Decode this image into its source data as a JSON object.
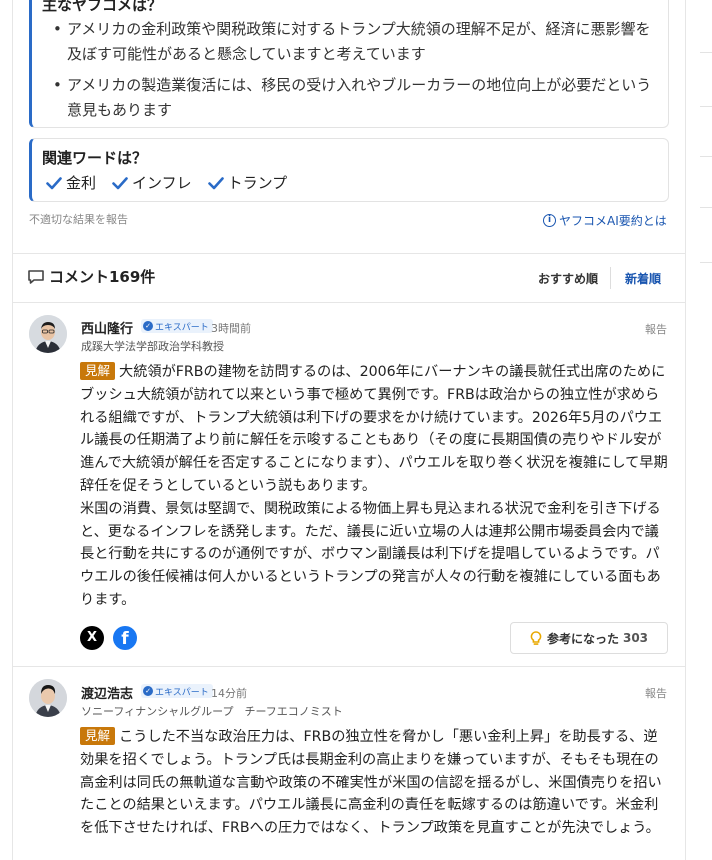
{
  "summary": {
    "title": "主なヤフコメは？",
    "items": [
      "アメリカの金利政策や関税政策に対するトランプ大統領の理解不足が、経済に悪影響を及ぼす可能性があると懸念していますと考えています",
      "アメリカの製造業復活には、移民の受け入れやブルーカラーの地位向上が必要だという意見もあります"
    ]
  },
  "related": {
    "title": "関連ワードは？",
    "words": [
      "金利",
      "インフレ",
      "トランプ"
    ]
  },
  "report_inappropriate": "不適切な結果を報告",
  "ai_summary_link": "ヤフコメAI要約とは",
  "comments_header": {
    "title": "コメント169件",
    "sort_recommended": "おすすめ順",
    "sort_newest": "新着順"
  },
  "comments": [
    {
      "author": "西山隆行",
      "badge": "エキスパート",
      "time": "3時間前",
      "report": "報告",
      "affiliation": "成蹊大学法学部政治学科教授",
      "tag": "見解",
      "paragraph1": "大統領がFRBの建物を訪問するのは、2006年にバーナンキの議長就任式出席のためにブッシュ大統領が訪れて以来という事で極めて異例です。FRBは政治からの独立性が求められる組織ですが、トランプ大統領は利下げの要求をかけ続けています。2026年5月のパウエル議長の任期満了より前に解任を示唆することもあり（その度に長期国債の売りやドル安が進んで大統領が解任を否定することになります）、パウエルを取り巻く状況を複雑にして早期辞任を促そうとしているという説もあります。",
      "paragraph2": "米国の消費、景気は堅調で、関税政策による物価上昇も見込まれる状況で金利を引き下げると、更なるインフレを誘発します。ただ、議長に近い立場の人は連邦公開市場委員会内で議長と行動を共にするのが通例ですが、ボウマン副議長は利下げを提唱しているようです。パウエルの後任候補は何人かいるというトランプの発言が人々の行動を複雑にしている面もあります。",
      "helpful_label": "参考になった",
      "helpful_count": "303"
    },
    {
      "author": "渡辺浩志",
      "badge": "エキスパート",
      "time": "14分前",
      "report": "報告",
      "affiliation": "ソニーフィナンシャルグループ　チーフエコノミスト",
      "tag": "見解",
      "paragraph1": "こうした不当な政治圧力は、FRBの独立性を脅かし「悪い金利上昇」を助長する、逆効果を招くでしょう。トランプ氏は長期金利の高止まりを嫌っていますが、そもそも現在の高金利は同氏の無軌道な言動や政策の不確実性が米国の信認を揺るがし、米国債売りを招いたことの結果といえます。パウエル議長に高金利の責任を転嫁するのは筋違いです。米金利を低下させたければ、FRBへの圧力ではなく、トランプ政策を見直すことが先決でしょう。"
    }
  ],
  "share": {
    "x": "X",
    "facebook": "f"
  }
}
